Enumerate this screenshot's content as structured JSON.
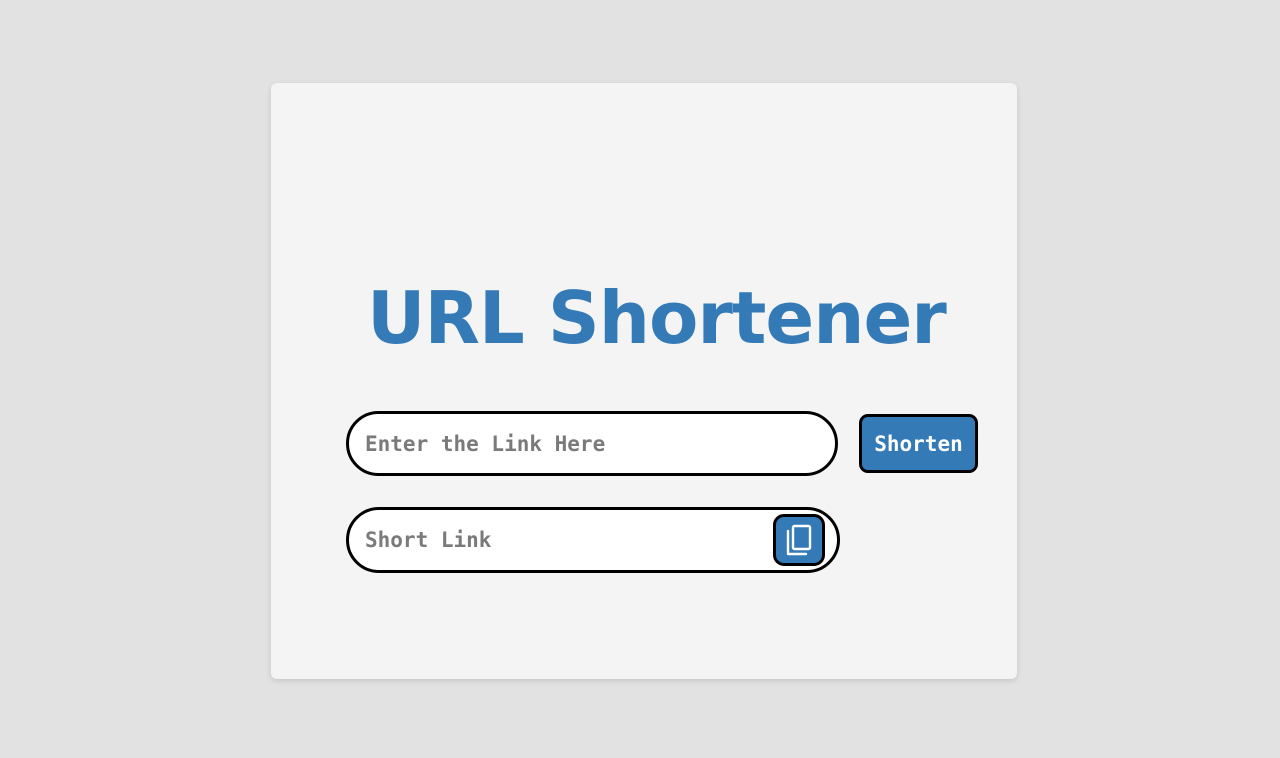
{
  "app": {
    "title": "URL Shortener",
    "accent_color": "#337ab7",
    "background_color": "#e2e2e2",
    "card_color": "#f4f4f4"
  },
  "form": {
    "link_input": {
      "value": "",
      "placeholder": "Enter the Link Here"
    },
    "shorten_button_label": "Shorten"
  },
  "result": {
    "short_link": {
      "value": "",
      "placeholder": "Short Link"
    },
    "copy_icon": "copy-icon"
  }
}
